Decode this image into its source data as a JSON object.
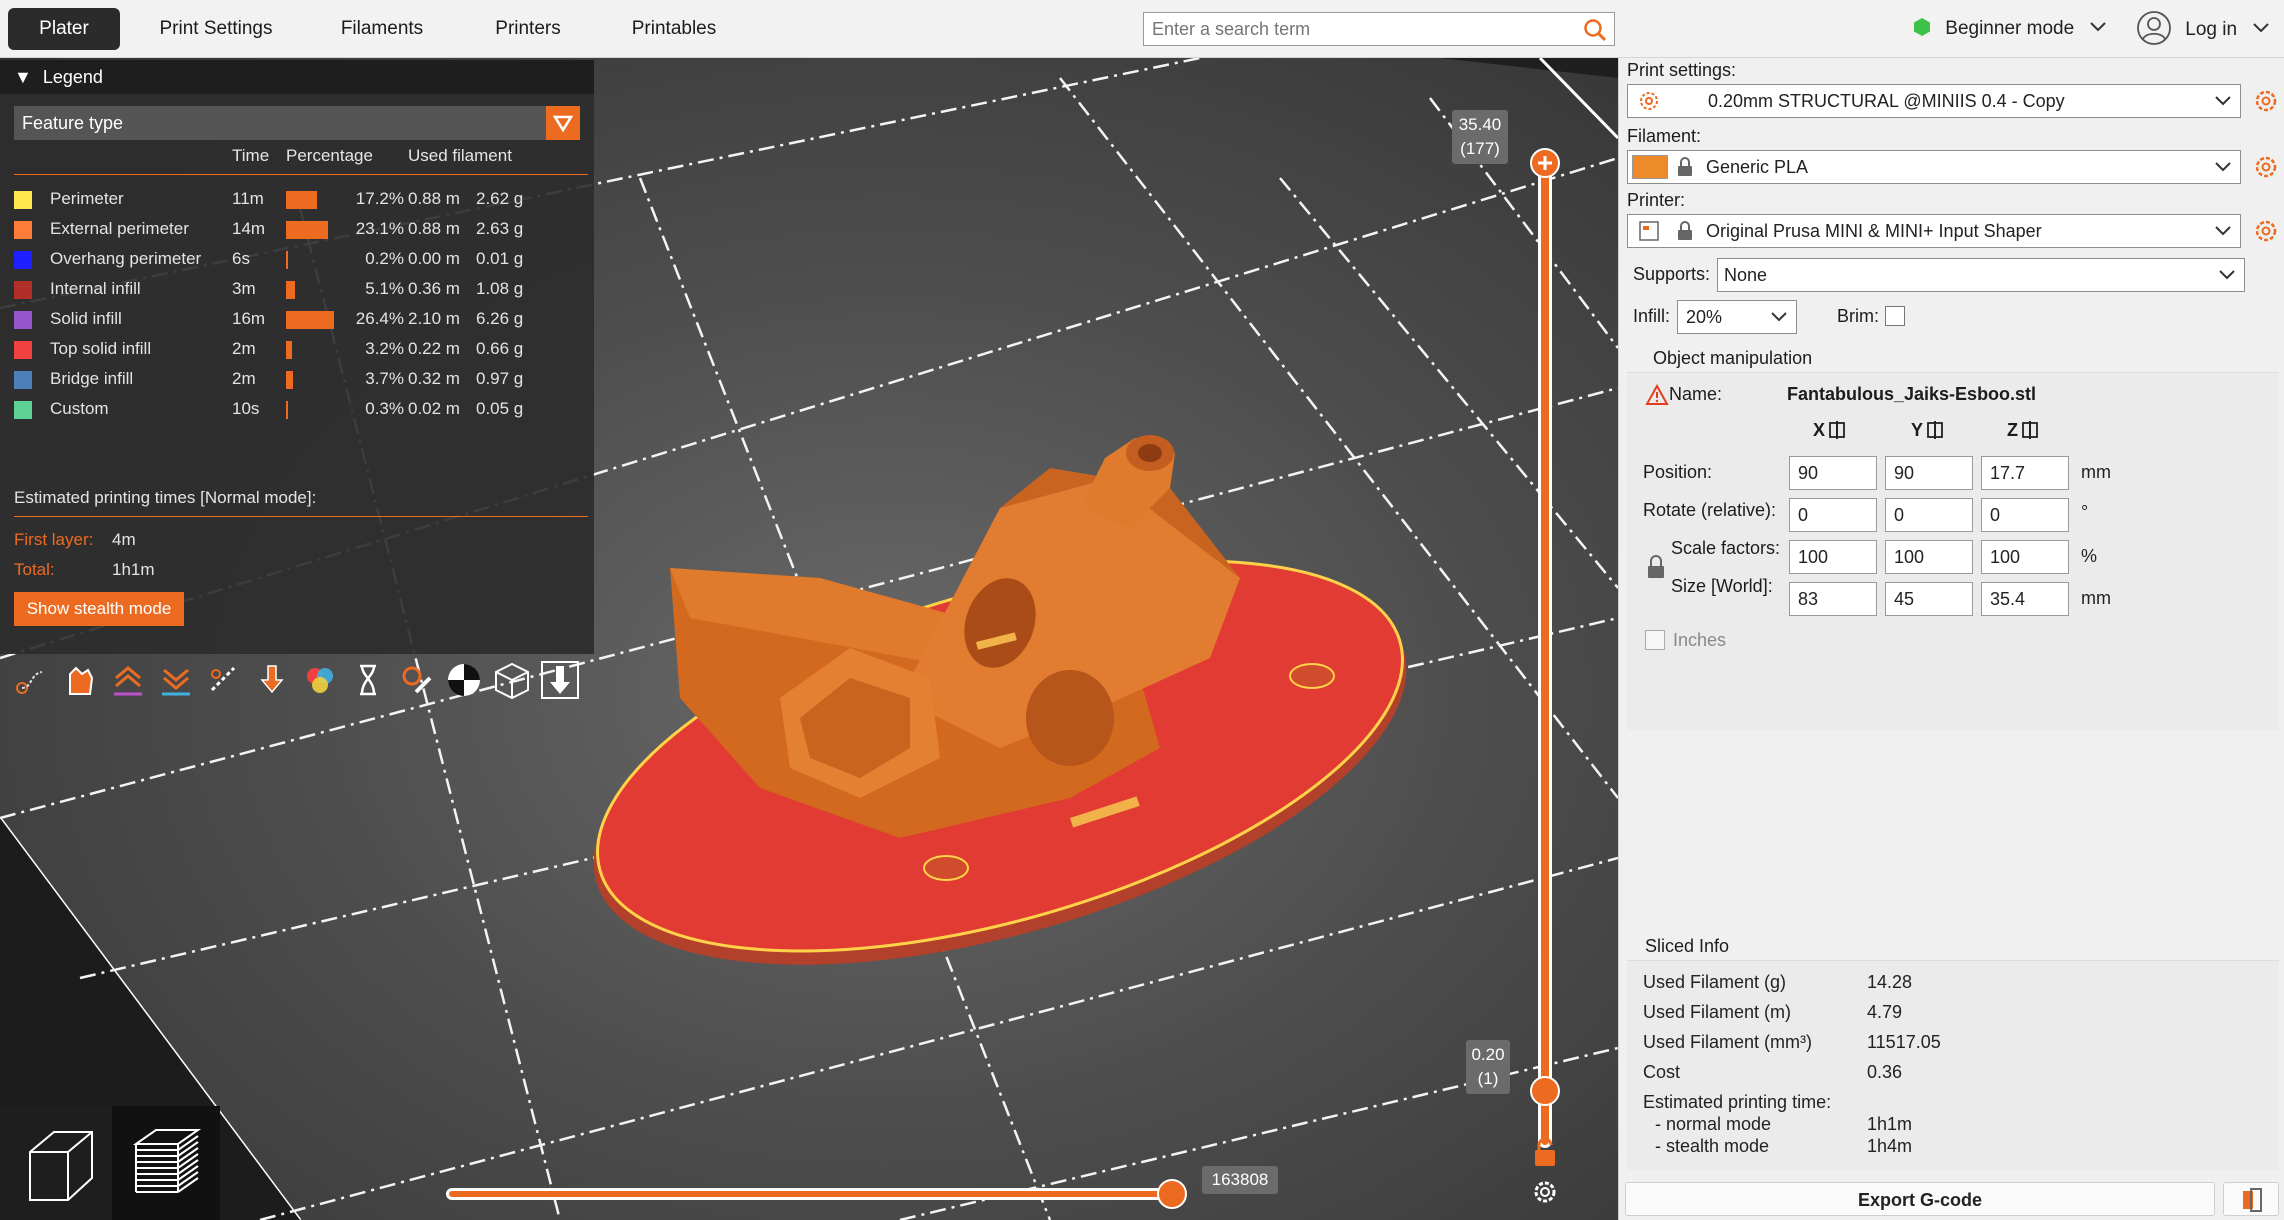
{
  "tabs": [
    "Plater",
    "Print Settings",
    "Filaments",
    "Printers",
    "Printables"
  ],
  "search": {
    "placeholder": "Enter a search term"
  },
  "mode": "Beginner mode",
  "login": "Log in",
  "legend": {
    "title": "Legend",
    "view_type": "Feature type",
    "headers": {
      "time": "Time",
      "percentage": "Percentage",
      "used_filament": "Used filament"
    },
    "rows": [
      {
        "name": "Perimeter",
        "time": "11m",
        "percentage": "17.2%",
        "fraction": 0.172,
        "meters": "0.88 m",
        "grams": "2.62 g",
        "color": "#ffe84d"
      },
      {
        "name": "External perimeter",
        "time": "14m",
        "percentage": "23.1%",
        "fraction": 0.231,
        "meters": "0.88 m",
        "grams": "2.63 g",
        "color": "#ff7d38"
      },
      {
        "name": "Overhang perimeter",
        "time": "6s",
        "percentage": "0.2%",
        "fraction": 0.002,
        "meters": "0.00 m",
        "grams": "0.01 g",
        "color": "#1f1fff"
      },
      {
        "name": "Internal infill",
        "time": "3m",
        "percentage": "5.1%",
        "fraction": 0.051,
        "meters": "0.36 m",
        "grams": "1.08 g",
        "color": "#b03029"
      },
      {
        "name": "Solid infill",
        "time": "16m",
        "percentage": "26.4%",
        "fraction": 0.264,
        "meters": "2.10 m",
        "grams": "6.26 g",
        "color": "#9654cc"
      },
      {
        "name": "Top solid infill",
        "time": "2m",
        "percentage": "3.2%",
        "fraction": 0.032,
        "meters": "0.22 m",
        "grams": "0.66 g",
        "color": "#f04040"
      },
      {
        "name": "Bridge infill",
        "time": "2m",
        "percentage": "3.7%",
        "fraction": 0.037,
        "meters": "0.32 m",
        "grams": "0.97 g",
        "color": "#4d80ba"
      },
      {
        "name": "Custom",
        "time": "10s",
        "percentage": "0.3%",
        "fraction": 0.003,
        "meters": "0.02 m",
        "grams": "0.05 g",
        "color": "#5ed194"
      }
    ],
    "estimated_title": "Estimated printing times [Normal mode]:",
    "first_layer_label": "First layer:",
    "first_layer": "4m",
    "total_label": "Total:",
    "total": "1h1m",
    "stealth_button": "Show stealth mode"
  },
  "slider": {
    "top_height": "35.40",
    "top_layer": "(177)",
    "bottom_height": "0.20",
    "bottom_layer": "(1)",
    "horizontal_value": "163808"
  },
  "panel": {
    "print_settings_label": "Print settings:",
    "print_settings_value": "0.20mm STRUCTURAL @MINIIS 0.4 - Copy",
    "filament_label": "Filament:",
    "filament_value": "Generic PLA",
    "filament_color": "#ed8a2a",
    "printer_label": "Printer:",
    "printer_value": "Original Prusa MINI & MINI+ Input Shaper",
    "supports_label": "Supports:",
    "supports_value": "None",
    "infill_label": "Infill:",
    "infill_value": "20%",
    "brim_label": "Brim:",
    "object_manipulation": "Object manipulation",
    "name_label": "Name:",
    "name_value": "Fantabulous_Jaiks-Esboo.stl",
    "axis_x": "X",
    "axis_y": "Y",
    "axis_z": "Z",
    "position_label": "Position:",
    "position": [
      "90",
      "90",
      "17.7"
    ],
    "position_unit": "mm",
    "rotate_label": "Rotate (relative):",
    "rotate": [
      "0",
      "0",
      "0"
    ],
    "rotate_unit": "°",
    "scale_label": "Scale factors:",
    "scale": [
      "100",
      "100",
      "100"
    ],
    "scale_unit": "%",
    "size_label": "Size [World]:",
    "size": [
      "83",
      "45",
      "35.4"
    ],
    "size_unit": "mm",
    "inches_label": "Inches",
    "sliced_info_title": "Sliced Info",
    "sliced_info": [
      {
        "k": "Used Filament (g)",
        "v": "14.28"
      },
      {
        "k": "Used Filament (m)",
        "v": "4.79"
      },
      {
        "k": "Used Filament (mm³)",
        "v": "11517.05"
      },
      {
        "k": "Cost",
        "v": "0.36"
      }
    ],
    "est_time_label": "Estimated printing time:",
    "normal_label": "- normal mode",
    "normal_value": "1h1m",
    "stealth_label": "- stealth mode",
    "stealth_value": "1h4m",
    "export_button": "Export G-code"
  }
}
